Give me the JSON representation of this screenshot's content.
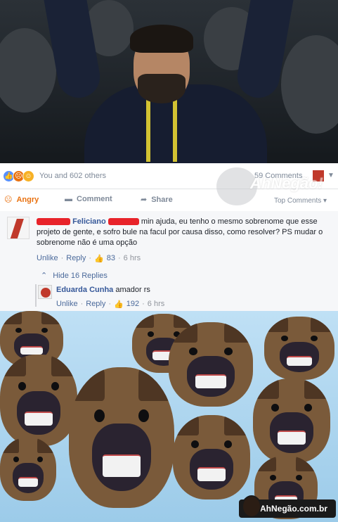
{
  "reactions": {
    "summary": "You and 602 others",
    "comments_count": "59 Comments"
  },
  "actions": {
    "angry_label": "Angry",
    "comment_label": "Comment",
    "share_label": "Share",
    "top_comments_label": "Top Comments"
  },
  "watermark": {
    "text": "AhNegão!"
  },
  "comment": {
    "author_visible": "Feliciano",
    "text": "min ajuda, eu tenho o mesmo sobrenome que esse projeto de gente, e sofro bule na facul por causa disso, como resolver? PS mudar o sobrenome não é uma opção",
    "unlike_label": "Unlike",
    "reply_label": "Reply",
    "likes": "83",
    "time": "6 hrs"
  },
  "replies": {
    "hide_label": "Hide 16 Replies",
    "items": [
      {
        "author": "Eduarda Cunha",
        "text": "amador rs",
        "unlike_label": "Unlike",
        "reply_label": "Reply",
        "likes": "192",
        "time": "6 hrs"
      }
    ]
  },
  "brand": {
    "text": "AhNegão.com.br"
  },
  "colors": {
    "link": "#365899",
    "meta": "#90949c",
    "angry": "#e9710f",
    "redaction": "#e8232a"
  }
}
